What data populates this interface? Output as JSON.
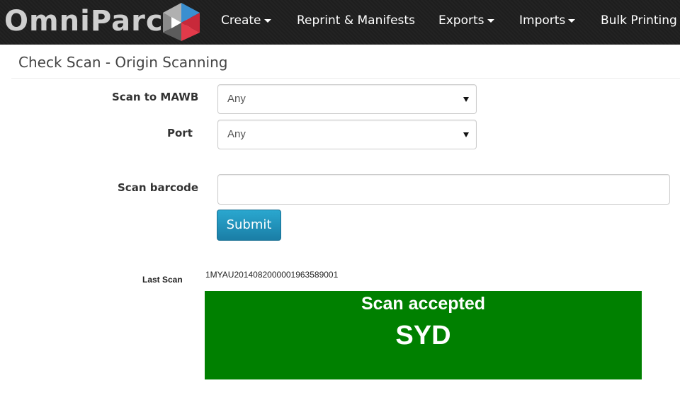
{
  "brand": {
    "name": "OmniParcel"
  },
  "nav": {
    "items": [
      {
        "label": "Create",
        "dropdown": true
      },
      {
        "label": "Reprint & Manifests",
        "dropdown": false
      },
      {
        "label": "Exports",
        "dropdown": true
      },
      {
        "label": "Imports",
        "dropdown": true
      },
      {
        "label": "Bulk Printing",
        "dropdown": true
      }
    ]
  },
  "page": {
    "title": "Check Scan - Origin Scanning"
  },
  "form": {
    "mawb": {
      "label": "Scan to MAWB",
      "value": "Any"
    },
    "port": {
      "label": "Port",
      "value": "Any"
    },
    "barcode": {
      "label": "Scan barcode",
      "value": ""
    },
    "submit_label": "Submit"
  },
  "last_scan": {
    "label": "Last Scan",
    "value": "1MYAU20140820000019635890​01",
    "status": "Scan accepted",
    "port": "SYD"
  },
  "colors": {
    "navbar": "#1e1e1e",
    "accepted": "#008000",
    "button": "#1f8fb9"
  }
}
